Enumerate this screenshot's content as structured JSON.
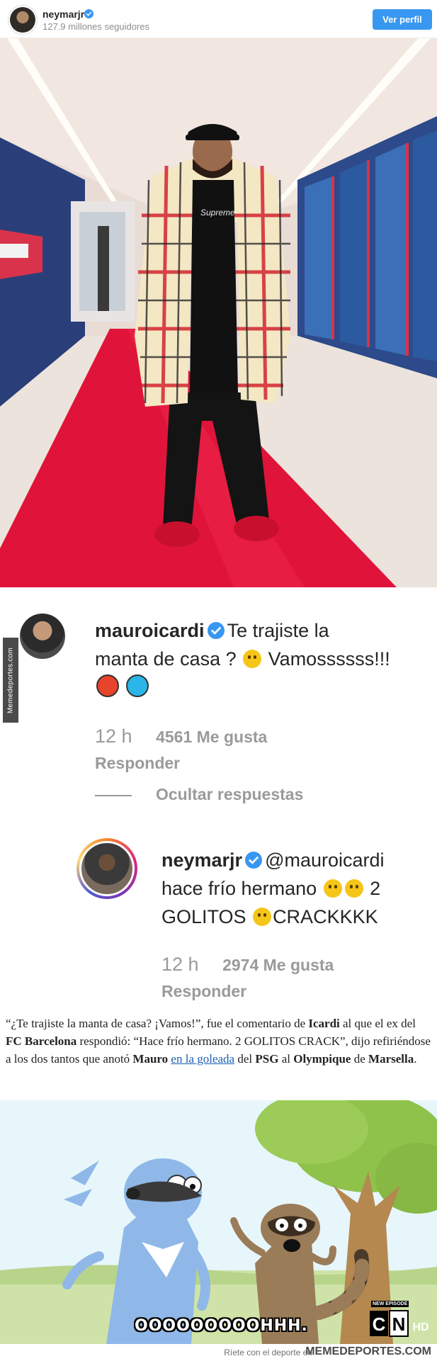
{
  "ig_header": {
    "username": "neymarjr",
    "followers": "127.9 millones seguidores",
    "view_profile": "Ver perfil"
  },
  "photo": {
    "shirt_text": "Supreme"
  },
  "side_tag": "Memedeportes.com",
  "comment1": {
    "username": "mauroicardi",
    "text_line1": "Te trajiste la",
    "text_line2": "manta de casa ?",
    "text_line2b": "Vamossssss!!!",
    "time": "12 h",
    "likes": "4561 Me gusta",
    "reply": "Responder",
    "hide_replies": "Ocultar respuestas"
  },
  "comment2": {
    "username": "neymarjr",
    "mention": "@mauroicardi",
    "text_line1": "hace frío hermano",
    "text_line1b": "2",
    "text_line2a": "GOLITOS",
    "text_line2b": "CRACKKKK",
    "time": "12 h",
    "likes": "2974 Me gusta",
    "reply": "Responder"
  },
  "article": {
    "p1": "“¿Te trajiste la manta de casa? ¡Vamos!”, fue el comentario de ",
    "b1": "Icardi",
    "p2": " al que el ex del ",
    "b2": "FC Barcelona",
    "p3": " respondió: “Hace frío hermano. 2 GOLITOS CRACK”, dijo refiriéndose a los dos tantos que anotó ",
    "b3": "Mauro",
    "p4": " ",
    "link": "en la goleada",
    "p5": " del ",
    "b4": "PSG",
    "p6": " al ",
    "b5": "Olympique",
    "p7": " de ",
    "b6": "Marsella",
    "p8": "."
  },
  "cartoon": {
    "subtitle": "OOOOOOOOOHHH.",
    "new_episode": "NEW EPISODE",
    "logo_c": "C",
    "logo_n": "N",
    "logo_hd": "HD"
  },
  "footer": {
    "tagline": "Ríete con el deporte en",
    "brand": "MEMEDEPORTES.COM"
  },
  "colors": {
    "ig_blue": "#3897f0",
    "verified": "#3897f0",
    "red_carpet": "#e0143a",
    "link": "#1a5fb4"
  }
}
